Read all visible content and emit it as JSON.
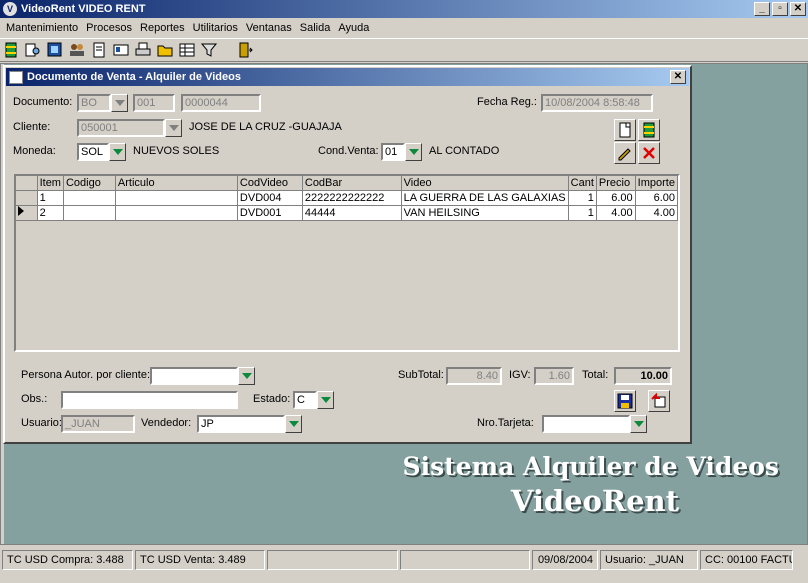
{
  "window": {
    "title": "VideoRent VIDEO RENT",
    "minimize": "_",
    "maximize": "▫",
    "close": "✕",
    "app_glyph": "V"
  },
  "menu": [
    "Mantenimiento",
    "Procesos",
    "Reportes",
    "Utilitarios",
    "Ventanas",
    "Salida",
    "Ayuda"
  ],
  "toolbar_icons": [
    "movie-icon",
    "video-search-icon",
    "film-stack-icon",
    "customers-icon",
    "document-icon",
    "id-card-icon",
    "printer-icon",
    "folder-icon",
    "grid-icon",
    "filter-icon",
    "exit-door-icon"
  ],
  "form": {
    "title": "Documento de Venta - Alquiler de Videos",
    "close": "✕",
    "documento_label": "Documento:",
    "doc_type": "BO",
    "doc_serie": "001",
    "doc_number": "0000044",
    "fecha_label": "Fecha Reg.:",
    "fecha_value": "10/08/2004 8:58:48",
    "cliente_label": "Cliente:",
    "cliente_code": "050001",
    "cliente_name": "JOSE DE LA CRUZ -GUAJAJA",
    "moneda_label": "Moneda:",
    "moneda_code": "SOL",
    "moneda_name": "NUEVOS SOLES",
    "cond_label": "Cond.Venta:",
    "cond_code": "01",
    "cond_name": "AL CONTADO",
    "grid": {
      "headers": [
        "Item",
        "Codigo",
        "Articulo",
        "CodVideo",
        "CodBar",
        "Video",
        "Cant",
        "Precio",
        "Importe"
      ],
      "rows": [
        [
          "1",
          "",
          "",
          "DVD004",
          "2222222222222",
          "LA GUERRA DE LAS GALAXIAS",
          "1",
          "6.00",
          "6.00"
        ],
        [
          "2",
          "",
          "",
          "DVD001",
          "44444",
          "VAN HEILSING",
          "1",
          "4.00",
          "4.00"
        ]
      ]
    },
    "persona_label": "Persona Autor. por cliente:",
    "persona_value": "",
    "subtotal_label": "SubTotal:",
    "subtotal_value": "8.40",
    "igv_label": "IGV:",
    "igv_value": "1.60",
    "total_label": "Total:",
    "total_value": "10.00",
    "obs_label": "Obs.:",
    "obs_value": "",
    "estado_label": "Estado:",
    "estado_value": "C",
    "usuario_label": "Usuario:",
    "usuario_value": "_JUAN",
    "vendedor_label": "Vendedor:",
    "vendedor_value": "JP",
    "tarjeta_label": "Nro.Tarjeta:",
    "tarjeta_value": ""
  },
  "background": {
    "line1": "Sistema Alquiler de Videos",
    "line2": "VideoRent"
  },
  "status": {
    "compra": "TC USD Compra:    3.488",
    "venta": "TC USD Venta:    3.489",
    "blank1": "",
    "blank2": "",
    "date": "09/08/2004",
    "user": "Usuario: _JUAN",
    "cc": "CC: 00100 FACTU"
  },
  "colors": {
    "titlebar_start": "#0a246a",
    "titlebar_end": "#a6caf0",
    "mdi_background": "#84a09f",
    "dropdown_arrow": "#0f8a3c"
  }
}
